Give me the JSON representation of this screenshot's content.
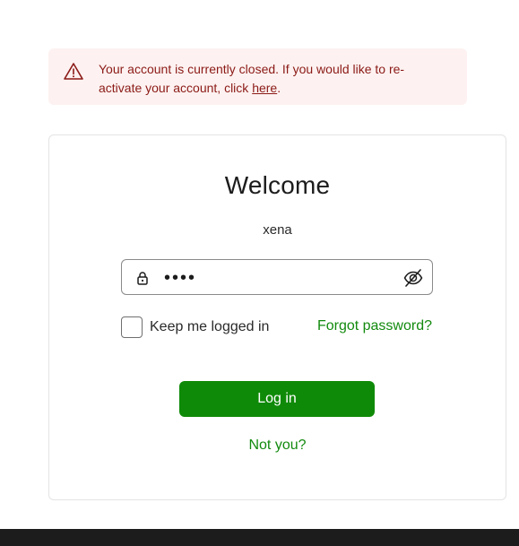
{
  "alert": {
    "message_prefix": "Your account is currently closed. If you would like to re-activate your account, click ",
    "link_text": "here",
    "message_suffix": ".",
    "icon": "warning-triangle-icon",
    "text_color": "#8b1a17",
    "background_color": "#fdf2f1"
  },
  "login": {
    "title": "Welcome",
    "username": "xena",
    "password_value": "••••",
    "remember_label": "Keep me logged in",
    "forgot_label": "Forgot password?",
    "login_button_label": "Log in",
    "not_you_label": "Not you?",
    "accent_color": "#0f8a08"
  }
}
